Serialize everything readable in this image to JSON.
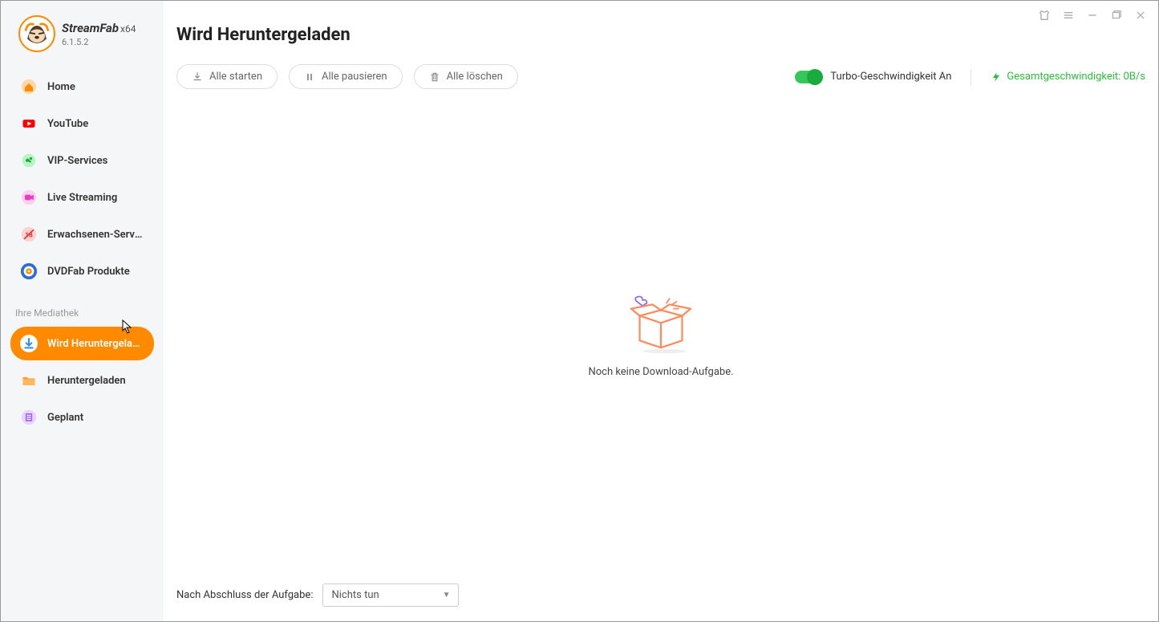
{
  "app": {
    "name": "StreamFab",
    "arch": "x64",
    "version": "6.1.5.2"
  },
  "sidebar": {
    "items": [
      {
        "label": "Home"
      },
      {
        "label": "YouTube"
      },
      {
        "label": "VIP-Services"
      },
      {
        "label": "Live Streaming"
      },
      {
        "label": "Erwachsenen-Servi..."
      },
      {
        "label": "DVDFab Produkte"
      }
    ],
    "section_label": "Ihre Mediathek",
    "library": [
      {
        "label": "Wird Heruntergeladen"
      },
      {
        "label": "Heruntergeladen"
      },
      {
        "label": "Geplant"
      }
    ]
  },
  "page": {
    "title": "Wird Heruntergeladen",
    "start_all": "Alle starten",
    "pause_all": "Alle pausieren",
    "delete_all": "Alle löschen",
    "turbo_label": "Turbo-Geschwindigkeit An",
    "speed_label": "Gesamtgeschwindigkeit: 0B/s",
    "empty_text": "Noch keine Download-Aufgabe."
  },
  "footer": {
    "label": "Nach Abschluss der Aufgabe:",
    "selected": "Nichts tun"
  }
}
